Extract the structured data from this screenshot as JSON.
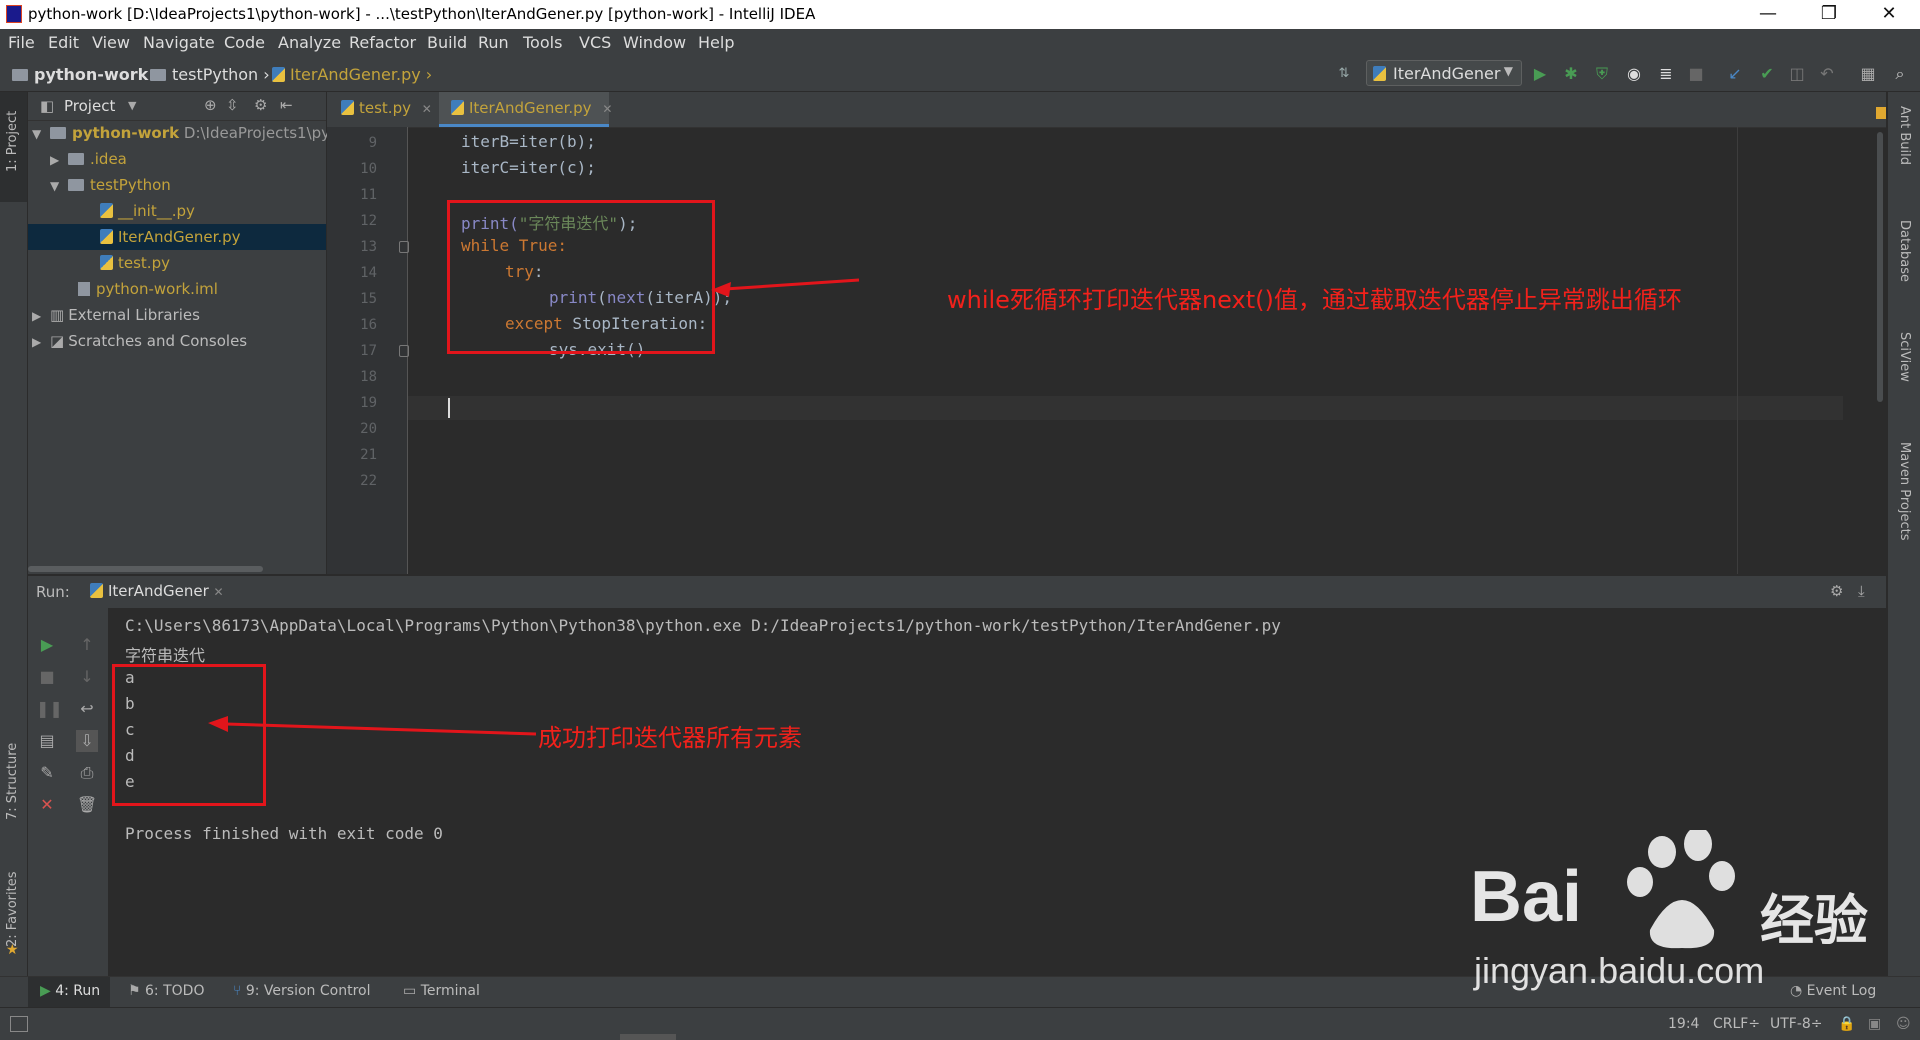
{
  "window": {
    "title": "python-work [D:\\IdeaProjects1\\python-work] - ...\\testPython\\IterAndGener.py [python-work] - IntelliJ IDEA",
    "minimize": "—",
    "restore": "❐",
    "close": "✕"
  },
  "menu": [
    "File",
    "Edit",
    "View",
    "Navigate",
    "Code",
    "Analyze",
    "Refactor",
    "Build",
    "Run",
    "Tools",
    "VCS",
    "Window",
    "Help"
  ],
  "breadcrumb": [
    "python-work",
    "testPython",
    "IterAndGener.py"
  ],
  "run_config": "IterAndGener",
  "project_panel": {
    "title": "Project",
    "tree": [
      {
        "label": "python-work",
        "path": "D:\\IdeaProjects1\\py",
        "level": 0,
        "expanded": "▼"
      },
      {
        "label": ".idea",
        "level": 1,
        "expanded": "▶"
      },
      {
        "label": "testPython",
        "level": 1,
        "expanded": "▼"
      },
      {
        "label": "__init__.py",
        "level": 2
      },
      {
        "label": "IterAndGener.py",
        "level": 2,
        "selected": true
      },
      {
        "label": "test.py",
        "level": 2
      },
      {
        "label": "python-work.iml",
        "level": 1
      },
      {
        "label": "External Libraries",
        "level": 0,
        "expanded": "▶"
      },
      {
        "label": "Scratches and Consoles",
        "level": 0,
        "expanded": "▶"
      }
    ]
  },
  "left_strip": {
    "project": "1: Project",
    "structure": "7: Structure",
    "favorites": "2: Favorites"
  },
  "right_strip": {
    "ant": "Ant Build",
    "database": "Database",
    "sciview": "SciView",
    "maven": "Maven Projects"
  },
  "editor_tabs": [
    {
      "label": "test.py",
      "active": false
    },
    {
      "label": "IterAndGener.py",
      "active": true
    }
  ],
  "code": {
    "line_numbers": [
      "9",
      "10",
      "11",
      "12",
      "13",
      "14",
      "15",
      "16",
      "17",
      "18",
      "19",
      "20",
      "21",
      "22"
    ],
    "l9": "iterB=iter(b);",
    "l10": "iterC=iter(c);",
    "l12a": "print(",
    "l12b": "\"字符串迭代\"",
    "l12c": ");",
    "l13a": "while",
    "l13b": " True:",
    "l14a": "try",
    "l14b": ":",
    "l15a": "print",
    "l15b": "(",
    "l15c": "next",
    "l15d": "(iterA));",
    "l16a": "except",
    "l16b": " StopIteration:",
    "l17": "sys.exit()"
  },
  "annotations": {
    "editor": "while死循环打印迭代器next()值，通过截取迭代器停止异常跳出循环",
    "console": "成功打印迭代器所有元素"
  },
  "run_panel": {
    "label": "Run:",
    "tab": "IterAndGener",
    "command": "C:\\Users\\86173\\AppData\\Local\\Programs\\Python\\Python38\\python.exe D:/IdeaProjects1/python-work/testPython/IterAndGener.py",
    "output_title": "字符串迭代",
    "output_items": [
      "a",
      "b",
      "c",
      "d",
      "e"
    ],
    "finish": "Process finished with exit code 0"
  },
  "bottom_tabs": [
    "4: Run",
    "6: TODO",
    "9: Version Control",
    "Terminal"
  ],
  "event_log": "Event Log",
  "status": {
    "position": "19:4",
    "line_sep": "CRLF÷",
    "encoding": "UTF-8÷"
  },
  "watermark": {
    "brand": "Bai",
    "brand2": "经验",
    "url": "jingyan.baidu.com"
  },
  "colors": {
    "accent": "#4a88c7",
    "annotation": "#e2151b",
    "keyword": "#cc7832",
    "string": "#6a8759",
    "builtin": "#8888c6",
    "run_green": "#499c54"
  }
}
